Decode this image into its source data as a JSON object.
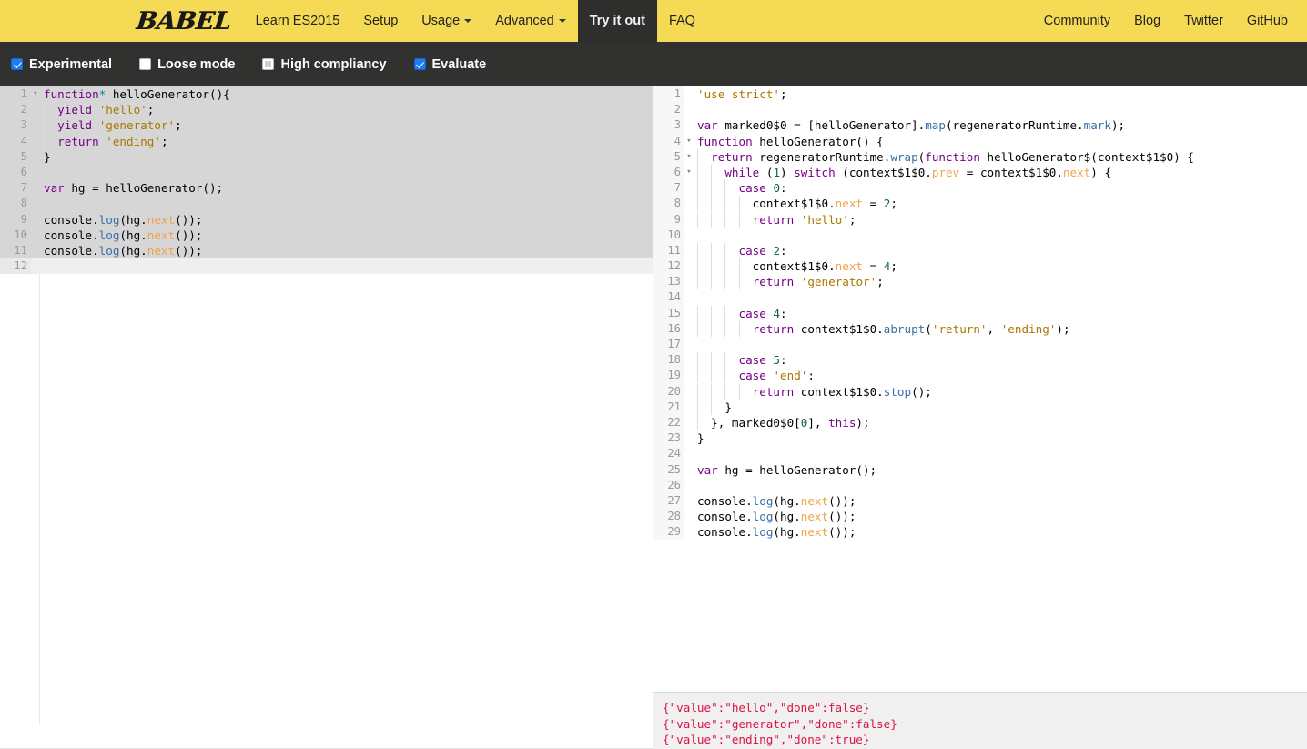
{
  "navbar": {
    "brand": "BABEL",
    "left_items": [
      {
        "label": "Learn ES2015",
        "has_caret": false,
        "active": false
      },
      {
        "label": "Setup",
        "has_caret": false,
        "active": false
      },
      {
        "label": "Usage",
        "has_caret": true,
        "active": false
      },
      {
        "label": "Advanced",
        "has_caret": true,
        "active": false
      },
      {
        "label": "Try it out",
        "has_caret": false,
        "active": true
      },
      {
        "label": "FAQ",
        "has_caret": false,
        "active": false
      }
    ],
    "right_items": [
      {
        "label": "Community"
      },
      {
        "label": "Blog"
      },
      {
        "label": "Twitter"
      },
      {
        "label": "GitHub"
      }
    ],
    "background_color": "#f5da55",
    "active_background_color": "#2e2e2c"
  },
  "options": [
    {
      "label": "Experimental",
      "checked": true,
      "state": "checked"
    },
    {
      "label": "Loose mode",
      "checked": false,
      "state": "unchecked"
    },
    {
      "label": "High compliancy",
      "checked": false,
      "state": "partial"
    },
    {
      "label": "Evaluate",
      "checked": true,
      "state": "checked"
    }
  ],
  "editor_input": {
    "total_lines": 12,
    "selected_lines": [
      1,
      2,
      3,
      4,
      5,
      6,
      7,
      8,
      9,
      10,
      11
    ],
    "cursor_line": 12,
    "lines": [
      {
        "n": 1,
        "fold": true,
        "text": "function* helloGenerator(){"
      },
      {
        "n": 2,
        "fold": false,
        "text": "  yield 'hello';"
      },
      {
        "n": 3,
        "fold": false,
        "text": "  yield 'generator';"
      },
      {
        "n": 4,
        "fold": false,
        "text": "  return 'ending';"
      },
      {
        "n": 5,
        "fold": false,
        "text": "}"
      },
      {
        "n": 6,
        "fold": false,
        "text": ""
      },
      {
        "n": 7,
        "fold": false,
        "text": "var hg = helloGenerator();"
      },
      {
        "n": 8,
        "fold": false,
        "text": ""
      },
      {
        "n": 9,
        "fold": false,
        "text": "console.log(hg.next());"
      },
      {
        "n": 10,
        "fold": false,
        "text": "console.log(hg.next());"
      },
      {
        "n": 11,
        "fold": false,
        "text": "console.log(hg.next());"
      },
      {
        "n": 12,
        "fold": false,
        "text": ""
      }
    ]
  },
  "editor_output": {
    "total_lines": 29,
    "lines": [
      {
        "n": 1,
        "fold": false,
        "text": "'use strict';"
      },
      {
        "n": 2,
        "fold": false,
        "text": ""
      },
      {
        "n": 3,
        "fold": false,
        "text": "var marked0$0 = [helloGenerator].map(regeneratorRuntime.mark);"
      },
      {
        "n": 4,
        "fold": true,
        "text": "function helloGenerator() {"
      },
      {
        "n": 5,
        "fold": true,
        "text": "  return regeneratorRuntime.wrap(function helloGenerator$(context$1$0) {"
      },
      {
        "n": 6,
        "fold": true,
        "text": "    while (1) switch (context$1$0.prev = context$1$0.next) {"
      },
      {
        "n": 7,
        "fold": false,
        "text": "      case 0:"
      },
      {
        "n": 8,
        "fold": false,
        "text": "        context$1$0.next = 2;"
      },
      {
        "n": 9,
        "fold": false,
        "text": "        return 'hello';"
      },
      {
        "n": 10,
        "fold": false,
        "text": ""
      },
      {
        "n": 11,
        "fold": false,
        "text": "      case 2:"
      },
      {
        "n": 12,
        "fold": false,
        "text": "        context$1$0.next = 4;"
      },
      {
        "n": 13,
        "fold": false,
        "text": "        return 'generator';"
      },
      {
        "n": 14,
        "fold": false,
        "text": ""
      },
      {
        "n": 15,
        "fold": false,
        "text": "      case 4:"
      },
      {
        "n": 16,
        "fold": false,
        "text": "        return context$1$0.abrupt('return', 'ending');"
      },
      {
        "n": 17,
        "fold": false,
        "text": ""
      },
      {
        "n": 18,
        "fold": false,
        "text": "      case 5:"
      },
      {
        "n": 19,
        "fold": false,
        "text": "      case 'end':"
      },
      {
        "n": 20,
        "fold": false,
        "text": "        return context$1$0.stop();"
      },
      {
        "n": 21,
        "fold": false,
        "text": "    }"
      },
      {
        "n": 22,
        "fold": false,
        "text": "  }, marked0$0[0], this);"
      },
      {
        "n": 23,
        "fold": false,
        "text": "}"
      },
      {
        "n": 24,
        "fold": false,
        "text": ""
      },
      {
        "n": 25,
        "fold": false,
        "text": "var hg = helloGenerator();"
      },
      {
        "n": 26,
        "fold": false,
        "text": ""
      },
      {
        "n": 27,
        "fold": false,
        "text": "console.log(hg.next());"
      },
      {
        "n": 28,
        "fold": false,
        "text": "console.log(hg.next());"
      },
      {
        "n": 29,
        "fold": false,
        "text": "console.log(hg.next());"
      }
    ]
  },
  "console_output": {
    "text_color": "#d14",
    "lines": [
      "{\"value\":\"hello\",\"done\":false}",
      "{\"value\":\"generator\",\"done\":false}",
      "{\"value\":\"ending\",\"done\":true}"
    ]
  }
}
